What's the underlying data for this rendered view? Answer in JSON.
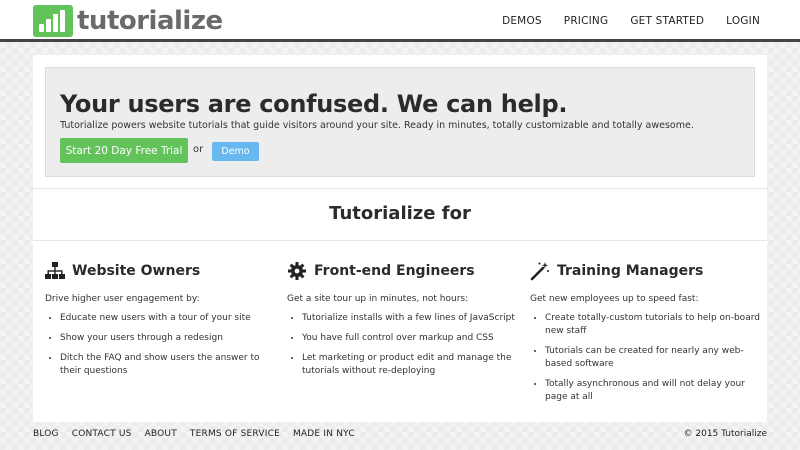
{
  "brand": {
    "name": "tutorialize",
    "color": "#63c35b"
  },
  "nav": {
    "items": [
      "DEMOS",
      "PRICING",
      "GET STARTED",
      "LOGIN"
    ]
  },
  "hero": {
    "title": "Your users are confused. We can help.",
    "subtitle": "Tutorialize powers website tutorials that guide visitors around your site. Ready in minutes, totally customizable and totally awesome.",
    "trial_button": "Start 20 Day Free Trial",
    "or_text": "or",
    "demo_button": "Demo"
  },
  "section": {
    "title": "Tutorialize for"
  },
  "columns": [
    {
      "icon": "sitemap-icon",
      "title": "Website Owners",
      "lead": "Drive higher user engagement by:",
      "items": [
        "Educate new users with a tour of your site",
        "Show your users through a redesign",
        "Ditch the FAQ and show users the answer to their questions"
      ]
    },
    {
      "icon": "gear-icon",
      "title": "Front-end Engineers",
      "lead": "Get a site tour up in minutes, not hours:",
      "items": [
        "Tutorialize installs with a few lines of JavaScript",
        "You have full control over markup and CSS",
        "Let marketing or product edit and manage the tutorials without re-deploying"
      ]
    },
    {
      "icon": "magic-wand-icon",
      "title": "Training Managers",
      "lead": "Get new employees up to speed fast:",
      "items": [
        "Create totally-custom tutorials to help on-board new staff",
        "Tutorials can be created for nearly any web-based software",
        "Totally asynchronous and will not delay your page at all"
      ]
    }
  ],
  "footer": {
    "links": [
      "BLOG",
      "CONTACT US",
      "ABOUT",
      "TERMS OF SERVICE",
      "MADE IN NYC"
    ],
    "copyright": "© 2015 Tutorialize"
  },
  "colors": {
    "accent_green": "#63c35b",
    "accent_blue": "#67b8ef",
    "header_border": "#444444"
  }
}
